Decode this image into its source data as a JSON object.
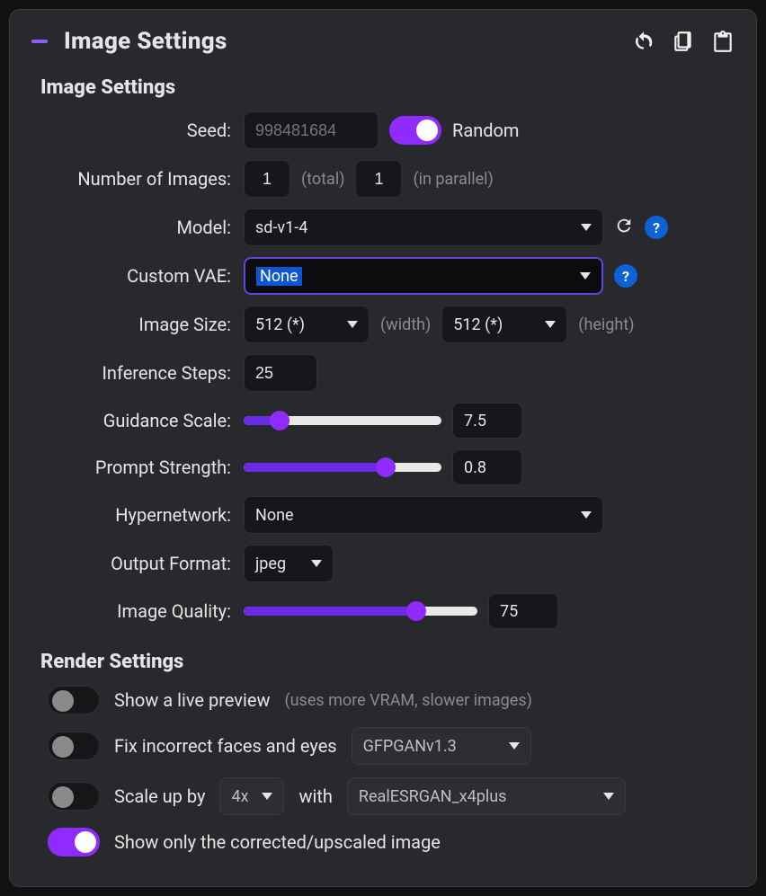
{
  "header": {
    "title": "Image Settings",
    "icons": {
      "undo": "undo-icon",
      "clipboard": "clipboard-icon",
      "paste": "paste-icon"
    }
  },
  "sections": {
    "image": {
      "title": "Image Settings",
      "seed": {
        "label": "Seed:",
        "placeholder": "998481684",
        "random_toggle_on": true,
        "random_label": "Random"
      },
      "num_images": {
        "label": "Number of Images:",
        "total": "1",
        "total_hint": "(total)",
        "parallel": "1",
        "parallel_hint": "(in parallel)"
      },
      "model": {
        "label": "Model:",
        "value": "sd-v1-4"
      },
      "vae": {
        "label": "Custom VAE:",
        "value": "None"
      },
      "size": {
        "label": "Image Size:",
        "width": "512 (*)",
        "width_hint": "(width)",
        "height": "512 (*)",
        "height_hint": "(height)"
      },
      "steps": {
        "label": "Inference Steps:",
        "value": "25"
      },
      "guidance": {
        "label": "Guidance Scale:",
        "value": "7.5",
        "pct": 18
      },
      "prompt_strength": {
        "label": "Prompt Strength:",
        "value": "0.8",
        "pct": 72
      },
      "hypernetwork": {
        "label": "Hypernetwork:",
        "value": "None"
      },
      "output_format": {
        "label": "Output Format:",
        "value": "jpeg"
      },
      "image_quality": {
        "label": "Image Quality:",
        "value": "75",
        "pct": 74
      }
    },
    "render": {
      "title": "Render Settings",
      "live_preview": {
        "on": false,
        "label": "Show a live preview",
        "hint": "(uses more VRAM, slower images)"
      },
      "fix_faces": {
        "on": false,
        "label": "Fix incorrect faces and eyes",
        "model": "GFPGANv1.3"
      },
      "upscale": {
        "on": false,
        "label_pre": "Scale up by",
        "factor": "4x",
        "label_mid": "with",
        "model": "RealESRGAN_x4plus"
      },
      "show_only_corrected": {
        "on": true,
        "label": "Show only the corrected/upscaled image"
      }
    }
  }
}
